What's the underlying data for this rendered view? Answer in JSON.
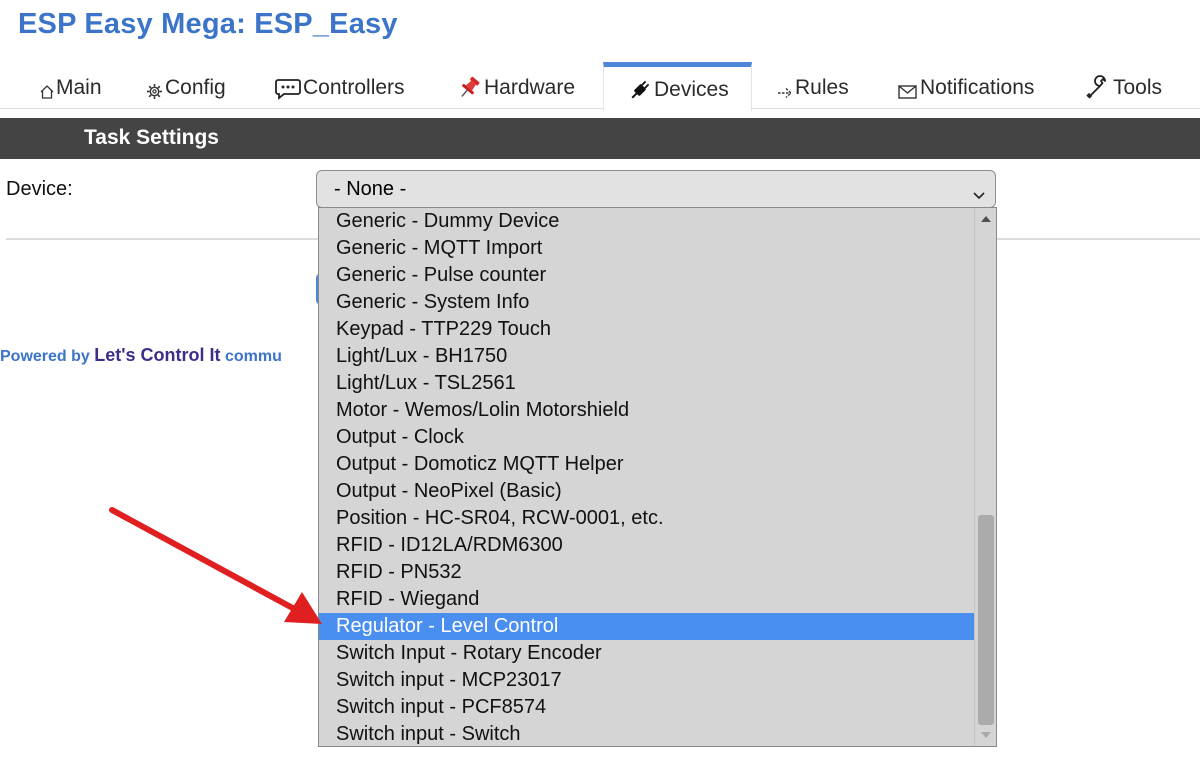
{
  "app": {
    "title": "ESP Easy Mega: ESP_Easy"
  },
  "nav": {
    "tabs": [
      {
        "icon": "home-icon",
        "label": "Main"
      },
      {
        "icon": "gear-icon",
        "label": "Config"
      },
      {
        "icon": "chat-icon",
        "label": "Controllers"
      },
      {
        "icon": "pushpin-icon",
        "label": "Hardware"
      },
      {
        "icon": "plug-icon",
        "label": "Devices",
        "active": true
      },
      {
        "icon": "arrow-right-icon",
        "label": "Rules"
      },
      {
        "icon": "envelope-icon",
        "label": "Notifications"
      },
      {
        "icon": "wrench-icon",
        "label": "Tools"
      }
    ],
    "accent_color": "#4d86d9"
  },
  "section": {
    "title": "Task Settings",
    "bar_color": "#444444"
  },
  "form": {
    "device_label": "Device:",
    "device_select": {
      "value": "- None -",
      "options": [
        "Generic - Dummy Device",
        "Generic - MQTT Import",
        "Generic - Pulse counter",
        "Generic - System Info",
        "Keypad - TTP229 Touch",
        "Light/Lux - BH1750",
        "Light/Lux - TSL2561",
        "Motor - Wemos/Lolin Motorshield",
        "Output - Clock",
        "Output - Domoticz MQTT Helper",
        "Output - NeoPixel (Basic)",
        "Position - HC-SR04, RCW-0001, etc.",
        "RFID - ID12LA/RDM6300",
        "RFID - PN532",
        "RFID - Wiegand",
        "Regulator - Level Control",
        "Switch Input - Rotary Encoder",
        "Switch input - MCP23017",
        "Switch input - PCF8574",
        "Switch input - Switch"
      ],
      "highlighted": "Regulator - Level Control",
      "highlight_color": "#4a8ef0"
    }
  },
  "footer": {
    "powered_by": "Powered by",
    "brand": "Let's Control It",
    "suffix": "commu"
  },
  "colors": {
    "title_blue": "#3b74c9",
    "annotation_arrow": "#e02020"
  }
}
